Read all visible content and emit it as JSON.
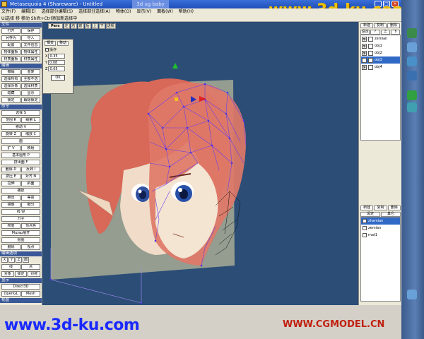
{
  "window": {
    "title": "Metasequoia 4 (Shareware) - Untitled",
    "tab": "3d ug baby",
    "minimize": "_",
    "maximize": "□",
    "close": "×"
  },
  "watermarks": {
    "top": "www.3d-ku.com",
    "bottom_left": "www.3d-ku.com",
    "bottom_right": "WWW.CGMODEL.CN"
  },
  "menu": [
    "文件(F)",
    "编辑(E)",
    "选择部分编辑(S)",
    "选择部分选择(A)",
    "物体(O)",
    "显示(V)",
    "面板(W)",
    "帮助(H)"
  ],
  "status_text": "Ui选择 移 移动  Shift+Ctrl添加新选择中",
  "left_panel": {
    "sections": [
      {
        "title": "文件",
        "rows": [
          [
            "打开",
            "保存"
          ],
          [
            "另存为",
            "导入"
          ],
          [
            "配置",
            "文件信息"
          ],
          [
            "物体面板",
            "物体属性"
          ],
          [
            "材质面板",
            "材质属性"
          ]
        ]
      },
      {
        "title": "编辑",
        "rows": [
          [
            "撤销",
            "重复"
          ],
          [
            "选择所有",
            "全部不选"
          ],
          [
            "选择对象",
            "选择材质"
          ],
          [
            "隐藏",
            "显示"
          ],
          [
            "锁定",
            "解除锁定"
          ]
        ]
      },
      {
        "title": "命令",
        "rows": [
          [
            "选择 S"
          ],
          [
            "范围 R",
            "绳索 L"
          ],
          [
            "移动 V"
          ],
          [
            "旋转 Z",
            "缩放 C"
          ],
          [
            "面"
          ],
          [
            "扩 V",
            "映射"
          ],
          [
            "基本图形 P"
          ],
          [
            "挤出面 F"
          ],
          [
            "删除 D",
            "反转 I"
          ],
          [
            "挤压 E",
            "对齐 N"
          ],
          [
            "拉伸",
            "斜面"
          ],
          [
            "捕捉"
          ],
          [
            "推出",
            "等高"
          ],
          [
            "镜像",
            "细分"
          ],
          [
            "线 W"
          ],
          [
            "刀子"
          ],
          [
            "权重",
            "顶点色"
          ],
          [
            "Mu/ap展开"
          ],
          [
            "贴图"
          ],
          [
            "删除",
            "视点"
          ]
        ]
      },
      {
        "title": "编辑选项",
        "rows": [
          [
            "X",
            "Y",
            "Z",
            "面"
          ],
          [
            "线",
            "点"
          ],
          [
            "对象",
            "锁定",
            "对称"
          ]
        ]
      },
      {
        "title": "显示",
        "rows": [
          [
            "Direct3D"
          ],
          [
            "OpenGL",
            "Mesh"
          ]
        ]
      },
      {
        "title": "视图",
        "rows": []
      }
    ]
  },
  "viewport": {
    "toolbar": [
      "Pers",
      "左",
      "右",
      "前",
      "后",
      "上",
      "下",
      "透视"
    ]
  },
  "dialog": {
    "tabs": [
      "相关",
      "移动"
    ],
    "checkbox_label": "操作",
    "fields": [
      {
        "label": "X",
        "value": "0.35"
      },
      {
        "label": "Y",
        "value": "0.08"
      },
      {
        "label": "Z",
        "value": "0.05"
      }
    ],
    "ok": "OK"
  },
  "right_panel": {
    "object_buttons": [
      "新建",
      "复制",
      "删除"
    ],
    "object_buttons2": [
      "设定",
      "?",
      "上",
      "下"
    ],
    "objects": [
      {
        "name": "zemian",
        "selected": false
      },
      {
        "name": "obj1",
        "selected": false
      },
      {
        "name": "obj2",
        "selected": false
      },
      {
        "name": "obj3",
        "selected": true
      },
      {
        "name": "obj4",
        "selected": false
      }
    ],
    "material_buttons": [
      "新建",
      "复制",
      "删除"
    ],
    "material_buttons2": [
      "设定",
      "其它"
    ],
    "materials": [
      {
        "name": "zhamian",
        "selected": true
      },
      {
        "name": "zemian",
        "selected": false
      },
      {
        "name": "mat1",
        "selected": false
      }
    ]
  },
  "colors": {
    "viewport_bg": "#2b4d76",
    "panel_bg": "#ece9d8",
    "selection": "#3169c6",
    "wire": "#6040e0",
    "hair": "#d86858"
  }
}
